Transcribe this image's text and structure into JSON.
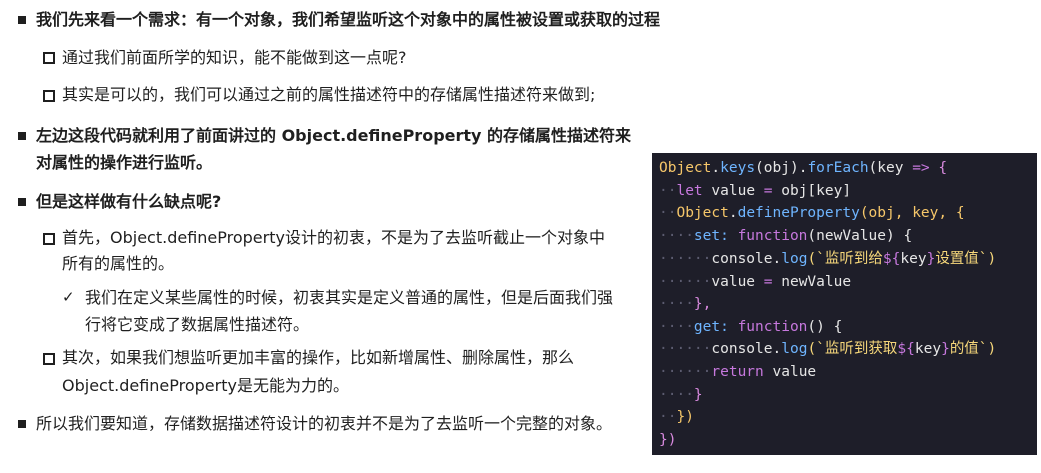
{
  "bullets": {
    "b1": "我们先来看一个需求：有一个对象，我们希望监听这个对象中的属性被设置或获取的过程",
    "b1_1": "通过我们前面所学的知识，能不能做到这一点呢?",
    "b1_2": "其实是可以的，我们可以通过之前的属性描述符中的存储属性描述符来做到;",
    "b2_line1": "左边这段代码就利用了前面讲过的 Object.defineProperty 的存储属性描述符来",
    "b2_line2": "对属性的操作进行监听。",
    "b3": "但是这样做有什么缺点呢?",
    "b3_1_line1": "首先，Object.defineProperty设计的初衷，不是为了去监听截止一个对象中",
    "b3_1_line2": "所有的属性的。",
    "b3_1_1_line1": "我们在定义某些属性的时候，初衷其实是定义普通的属性，但是后面我们强",
    "b3_1_1_line2": "行将它变成了数据属性描述符。",
    "b3_2_line1": "其次，如果我们想监听更加丰富的操作，比如新增属性、删除属性，那么",
    "b3_2_line2": "Object.defineProperty是无能为力的。",
    "b4": "所以我们要知道，存储数据描述符设计的初衷并不是为了去监听一个完整的对象。"
  },
  "code": {
    "l1_obj": "Object",
    "l1_a": ".",
    "l1_keys": "keys",
    "l1_b": "(obj).",
    "l1_forEach": "forEach",
    "l1_c": "(key ",
    "l1_arrow": "=>",
    "l1_d": " {",
    "l2_let": "let",
    "l2_a": " value ",
    "l2_eq": "=",
    "l2_b": " obj[key]",
    "l3_obj": "Object",
    "l3_a": ".",
    "l3_def": "defineProperty",
    "l3_b": "(obj, key, {",
    "l4_set": "set:",
    "l4_function": "function",
    "l4_a": "(newValue) {",
    "l5_console": "console.",
    "l5_log": "log",
    "l5_a": "(`监听到给",
    "l5_t1": "${",
    "l5_key": "key",
    "l5_t2": "}",
    "l5_b": "设置值`)",
    "l6_a": "value ",
    "l6_eq": "=",
    "l6_b": " newValue",
    "l7_a": "},",
    "l8_get": "get:",
    "l8_function": "function",
    "l8_a": "() {",
    "l9_console": "console.",
    "l9_log": "log",
    "l9_a": "(`监听到获取",
    "l9_t1": "${",
    "l9_key": "key",
    "l9_t2": "}",
    "l9_b": "的值`)",
    "l10_return": "return",
    "l10_a": " value",
    "l11_a": "}",
    "l12_a": "})",
    "l13_a": "})"
  }
}
